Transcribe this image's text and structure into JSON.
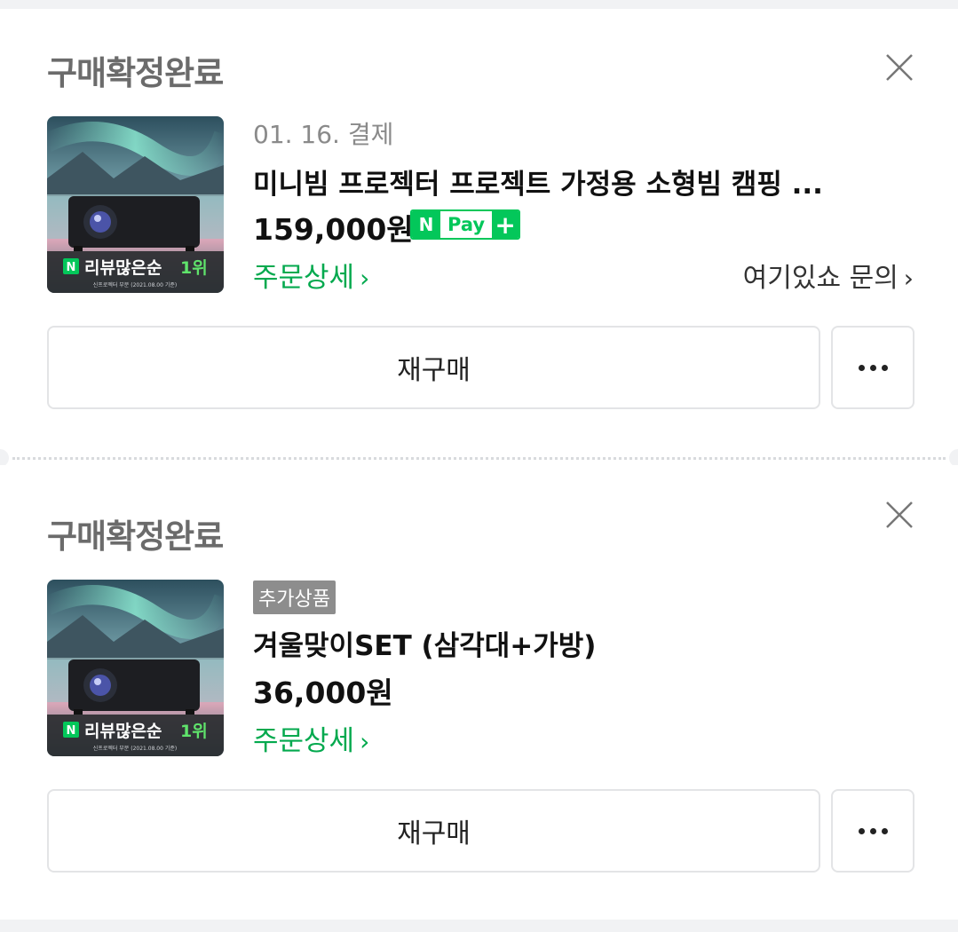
{
  "colors": {
    "accent_green": "#03c75a",
    "status_gray": "#6b6b6b"
  },
  "orders": [
    {
      "status": "구매확정완료",
      "date": "01. 16. 결제",
      "title": "미니빔 프로젝터 프로젝트 가정용 소형빔 캠핑 ...",
      "price": "159,000원",
      "npay": {
        "n": "N",
        "label": "Pay",
        "plus": "+"
      },
      "detail_label": "주문상세",
      "inquiry_label": "여기있쇼 문의",
      "thumb": {
        "badge_n": "N",
        "badge_text": "리뷰많은순",
        "badge_rank": "1위",
        "caption": "신프로젝터 부분 (2021.08.00 기준)"
      },
      "rebuy_label": "재구매",
      "icons": [
        "close-icon",
        "more-icon",
        "chevron-right-icon"
      ]
    },
    {
      "status": "구매확정완료",
      "badge": "추가상품",
      "title": "겨울맞이SET (삼각대+가방)",
      "price": "36,000원",
      "detail_label": "주문상세",
      "thumb": {
        "badge_n": "N",
        "badge_text": "리뷰많은순",
        "badge_rank": "1위",
        "caption": "신프로젝터 부분 (2021.08.00 기준)"
      },
      "rebuy_label": "재구매",
      "icons": [
        "close-icon",
        "more-icon",
        "chevron-right-icon"
      ]
    }
  ]
}
